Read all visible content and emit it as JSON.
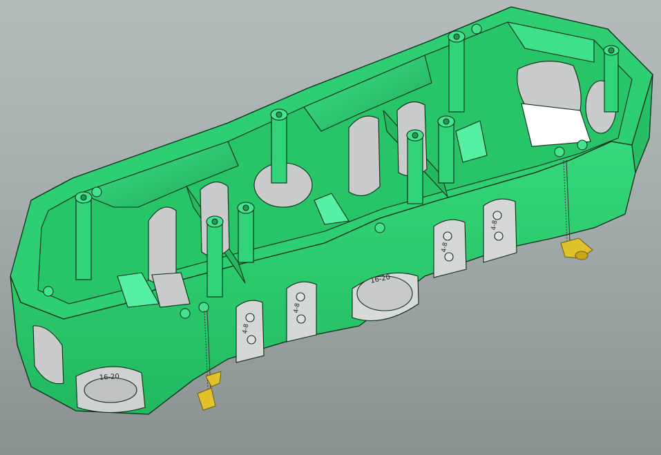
{
  "viewport": {
    "background_top": "#b4bdbb",
    "background_bottom": "#8a9291"
  },
  "model": {
    "body_color": "#2ecf72",
    "body_light": "#4ef09a",
    "body_dark": "#1a9e4e",
    "edge_color": "#0d2a18",
    "opening_color": "#c9cccb",
    "clamp_color": "#e1c22a",
    "labels": {
      "knockout_large_front": "16-20",
      "knockout_large_middle": "16-20",
      "knockout_small_1": "4-8",
      "knockout_small_2": "4-8",
      "knockout_small_3": "4-8",
      "knockout_small_4": "4-8"
    }
  }
}
